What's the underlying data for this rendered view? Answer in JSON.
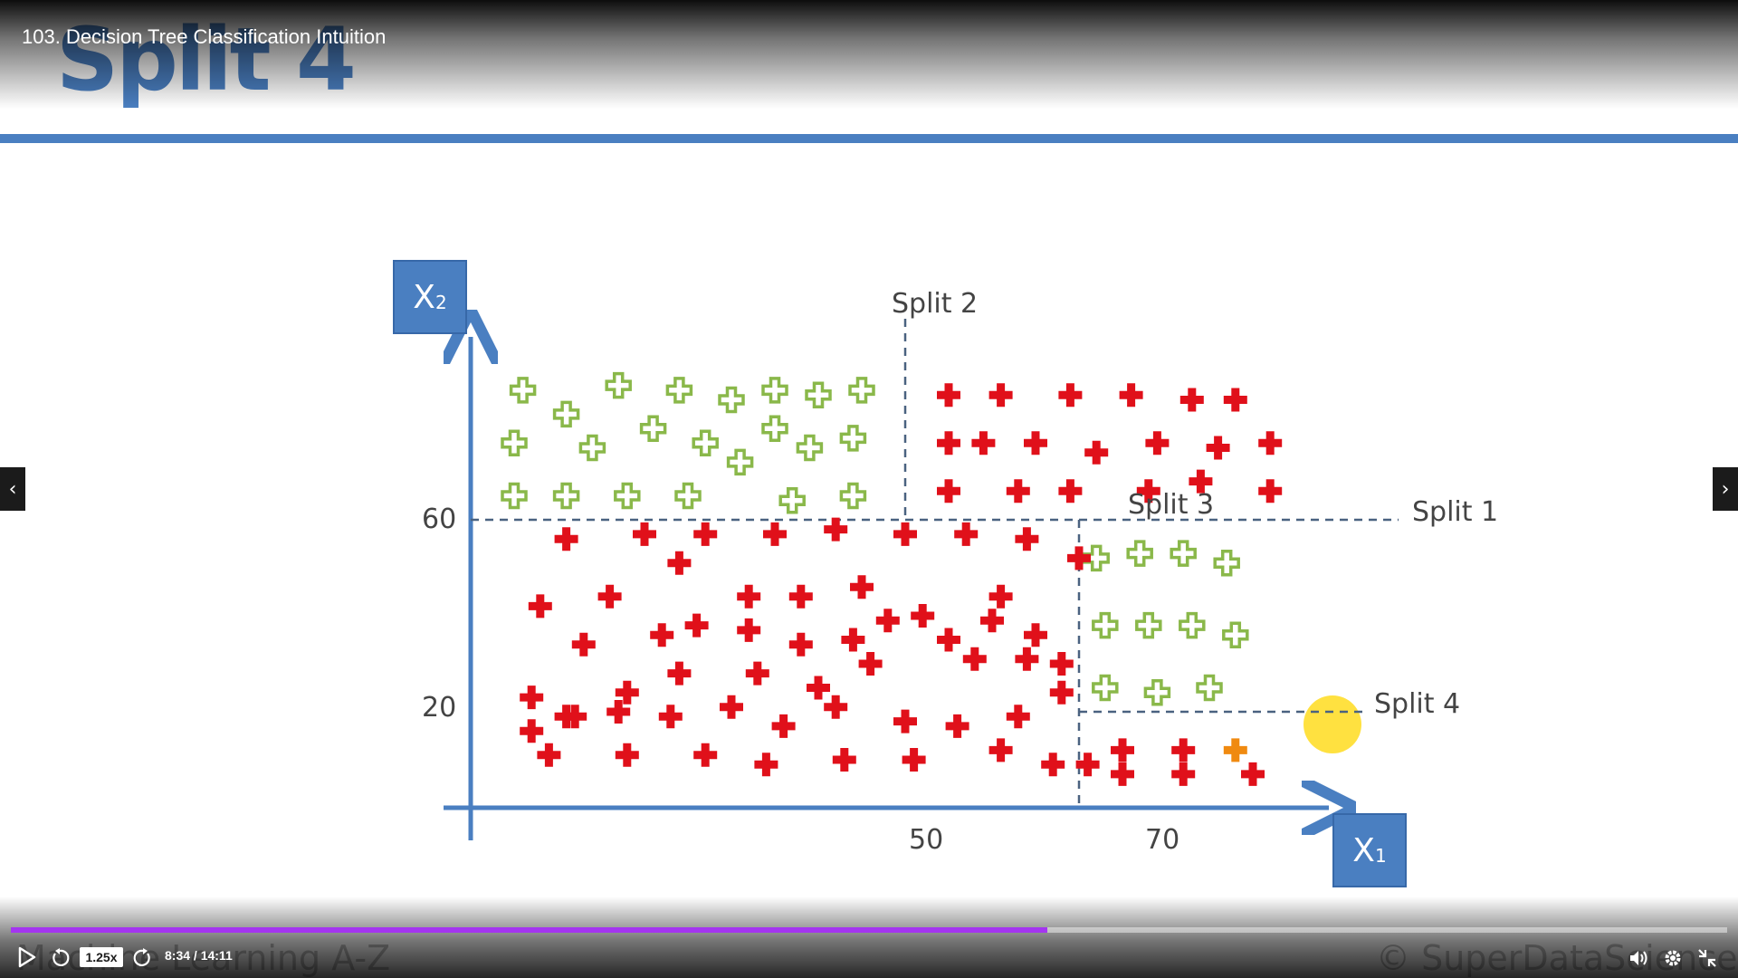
{
  "player": {
    "video_title": "103. Decision Tree Classification Intuition",
    "speed": "1.25x",
    "time": "8:34 / 14:11",
    "progress": 0.604
  },
  "slide": {
    "title": "Split 4",
    "footer_left": "Machine Learning A-Z",
    "footer_right": "© SuperDataScience"
  },
  "colors": {
    "accent_blue": "#4a7fc1",
    "green_point": "#8ab84a",
    "red_point": "#e0101a",
    "highlight": "#ffdc1e",
    "progress_purple": "#a435f0"
  },
  "icons": {
    "play": "play-icon",
    "rewind": "rewind-icon",
    "forward": "forward-icon",
    "volume": "volume-icon",
    "settings": "gear-icon",
    "fullscreen": "exit-fullscreen-icon",
    "prev": "chevron-left-icon",
    "next": "chevron-right-icon"
  },
  "chart_data": {
    "type": "scatter",
    "xlabel_main": "X",
    "xlabel_sub": "1",
    "ylabel_main": "X",
    "ylabel_sub": "2",
    "x_ticks": [
      "50",
      "70"
    ],
    "y_ticks": [
      "60",
      "20"
    ],
    "xlim": [
      0,
      100
    ],
    "ylim": [
      0,
      100
    ],
    "splits": [
      {
        "label": "Split 1",
        "axis": "y",
        "value": 60
      },
      {
        "label": "Split 2",
        "axis": "x",
        "value": 50,
        "range": [
          60,
          100
        ]
      },
      {
        "label": "Split 3",
        "axis": "x",
        "value": 70,
        "range": [
          0,
          60
        ]
      },
      {
        "label": "Split 4",
        "axis": "y",
        "value": 20,
        "range": [
          70,
          100
        ]
      }
    ],
    "series": [
      {
        "name": "green",
        "marker": "plus-outline",
        "points": [
          [
            6,
            87
          ],
          [
            11,
            82
          ],
          [
            17,
            88
          ],
          [
            24,
            87
          ],
          [
            30,
            85
          ],
          [
            35,
            87
          ],
          [
            40,
            86
          ],
          [
            45,
            87
          ],
          [
            5,
            76
          ],
          [
            14,
            75
          ],
          [
            21,
            79
          ],
          [
            27,
            76
          ],
          [
            35,
            79
          ],
          [
            39,
            75
          ],
          [
            44,
            77
          ],
          [
            31,
            72
          ],
          [
            5,
            65
          ],
          [
            11,
            65
          ],
          [
            18,
            65
          ],
          [
            25,
            65
          ],
          [
            37,
            64
          ],
          [
            44,
            65
          ],
          [
            72,
            52
          ],
          [
            77,
            53
          ],
          [
            82,
            53
          ],
          [
            87,
            51
          ],
          [
            73,
            38
          ],
          [
            78,
            38
          ],
          [
            83,
            38
          ],
          [
            88,
            36
          ],
          [
            73,
            25
          ],
          [
            79,
            24
          ],
          [
            85,
            25
          ]
        ]
      },
      {
        "name": "red",
        "marker": "plus-filled",
        "points": [
          [
            55,
            86
          ],
          [
            61,
            86
          ],
          [
            69,
            86
          ],
          [
            76,
            86
          ],
          [
            83,
            85
          ],
          [
            88,
            85
          ],
          [
            55,
            76
          ],
          [
            59,
            76
          ],
          [
            65,
            76
          ],
          [
            72,
            74
          ],
          [
            79,
            76
          ],
          [
            86,
            75
          ],
          [
            92,
            76
          ],
          [
            55,
            66
          ],
          [
            63,
            66
          ],
          [
            69,
            66
          ],
          [
            78,
            66
          ],
          [
            84,
            68
          ],
          [
            92,
            66
          ],
          [
            11,
            56
          ],
          [
            20,
            57
          ],
          [
            27,
            57
          ],
          [
            35,
            57
          ],
          [
            42,
            58
          ],
          [
            50,
            57
          ],
          [
            57,
            57
          ],
          [
            64,
            56
          ],
          [
            70,
            52
          ],
          [
            8,
            42
          ],
          [
            16,
            44
          ],
          [
            24,
            51
          ],
          [
            32,
            44
          ],
          [
            38,
            44
          ],
          [
            45,
            46
          ],
          [
            52,
            40
          ],
          [
            61,
            44
          ],
          [
            13,
            34
          ],
          [
            22,
            36
          ],
          [
            26,
            38
          ],
          [
            32,
            37
          ],
          [
            38,
            34
          ],
          [
            44,
            35
          ],
          [
            48,
            39
          ],
          [
            55,
            35
          ],
          [
            60,
            39
          ],
          [
            65,
            36
          ],
          [
            7,
            23
          ],
          [
            12,
            19
          ],
          [
            18,
            24
          ],
          [
            24,
            28
          ],
          [
            33,
            28
          ],
          [
            40,
            25
          ],
          [
            46,
            30
          ],
          [
            58,
            31
          ],
          [
            64,
            31
          ],
          [
            68,
            30
          ],
          [
            7,
            16
          ],
          [
            11,
            19
          ],
          [
            17,
            20
          ],
          [
            23,
            19
          ],
          [
            30,
            21
          ],
          [
            36,
            17
          ],
          [
            42,
            21
          ],
          [
            50,
            18
          ],
          [
            56,
            17
          ],
          [
            63,
            19
          ],
          [
            68,
            24
          ],
          [
            9,
            11
          ],
          [
            18,
            11
          ],
          [
            27,
            11
          ],
          [
            34,
            9
          ],
          [
            43,
            10
          ],
          [
            51,
            10
          ],
          [
            61,
            12
          ],
          [
            67,
            9
          ],
          [
            71,
            9
          ],
          [
            75,
            12
          ],
          [
            82,
            12
          ],
          [
            75,
            7
          ],
          [
            82,
            7
          ],
          [
            90,
            7
          ]
        ]
      },
      {
        "name": "highlighted",
        "marker": "plus-filled-orange",
        "points": [
          [
            88,
            12
          ]
        ]
      }
    ]
  }
}
